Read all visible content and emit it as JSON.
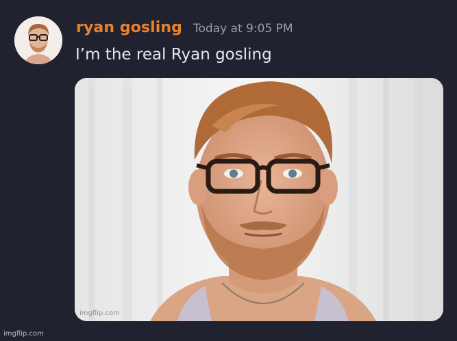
{
  "message": {
    "username": "ryan gosling",
    "timestamp": "Today at 9:05 PM",
    "text": "I’m the real Ryan gosling",
    "avatar_icon": "user-avatar-photo",
    "attachment_icon": "portrait-photo"
  },
  "colors": {
    "background": "#212230",
    "username": "#e8832c",
    "timestamp": "#9a9ca6",
    "text": "#e6e7ea"
  },
  "watermarks": {
    "inner": "imgflip.com",
    "page": "imgflip.com"
  }
}
